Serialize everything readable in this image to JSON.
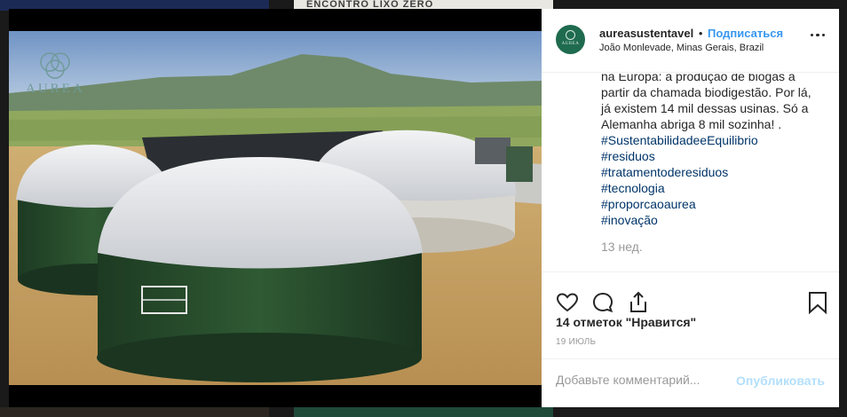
{
  "background": {
    "top_mid_text": "ENCONTRO LIXO ZERO"
  },
  "photo": {
    "watermark_text": "AUREA"
  },
  "post": {
    "avatar_text": "AUREA",
    "username": "aureasustentavel",
    "separator": "•",
    "follow_label": "Подписаться",
    "location": "João Monlevade, Minas Gerais, Brazil",
    "caption_lines": [
      "na Europa: a produção de biogas a",
      "partir da chamada biodigestão. Por lá,",
      "já existem 14 mil dessas usinas. Só a",
      "Alemanha abriga 8 mil sozinha! ."
    ],
    "hashtags": [
      "#SustentabilidadeeEquilibrio",
      "#residuos",
      "#tratamentoderesiduos",
      "#tecnologia",
      "#proporcaoaurea",
      "#inovação"
    ],
    "time_ago": "13 нед.",
    "likes": "14 отметок \"Нравится\"",
    "date": "19 ИЮЛЬ",
    "comment_placeholder": "Добавьте комментарий...",
    "publish_label": "Опубликовать"
  },
  "icons": {
    "like": "heart-icon",
    "comment": "comment-icon",
    "share": "share-icon",
    "save": "bookmark-icon",
    "more": "more-icon"
  },
  "colors": {
    "follow": "#3897f0",
    "hashtag": "#003569",
    "avatar": "#1f6b4f"
  }
}
